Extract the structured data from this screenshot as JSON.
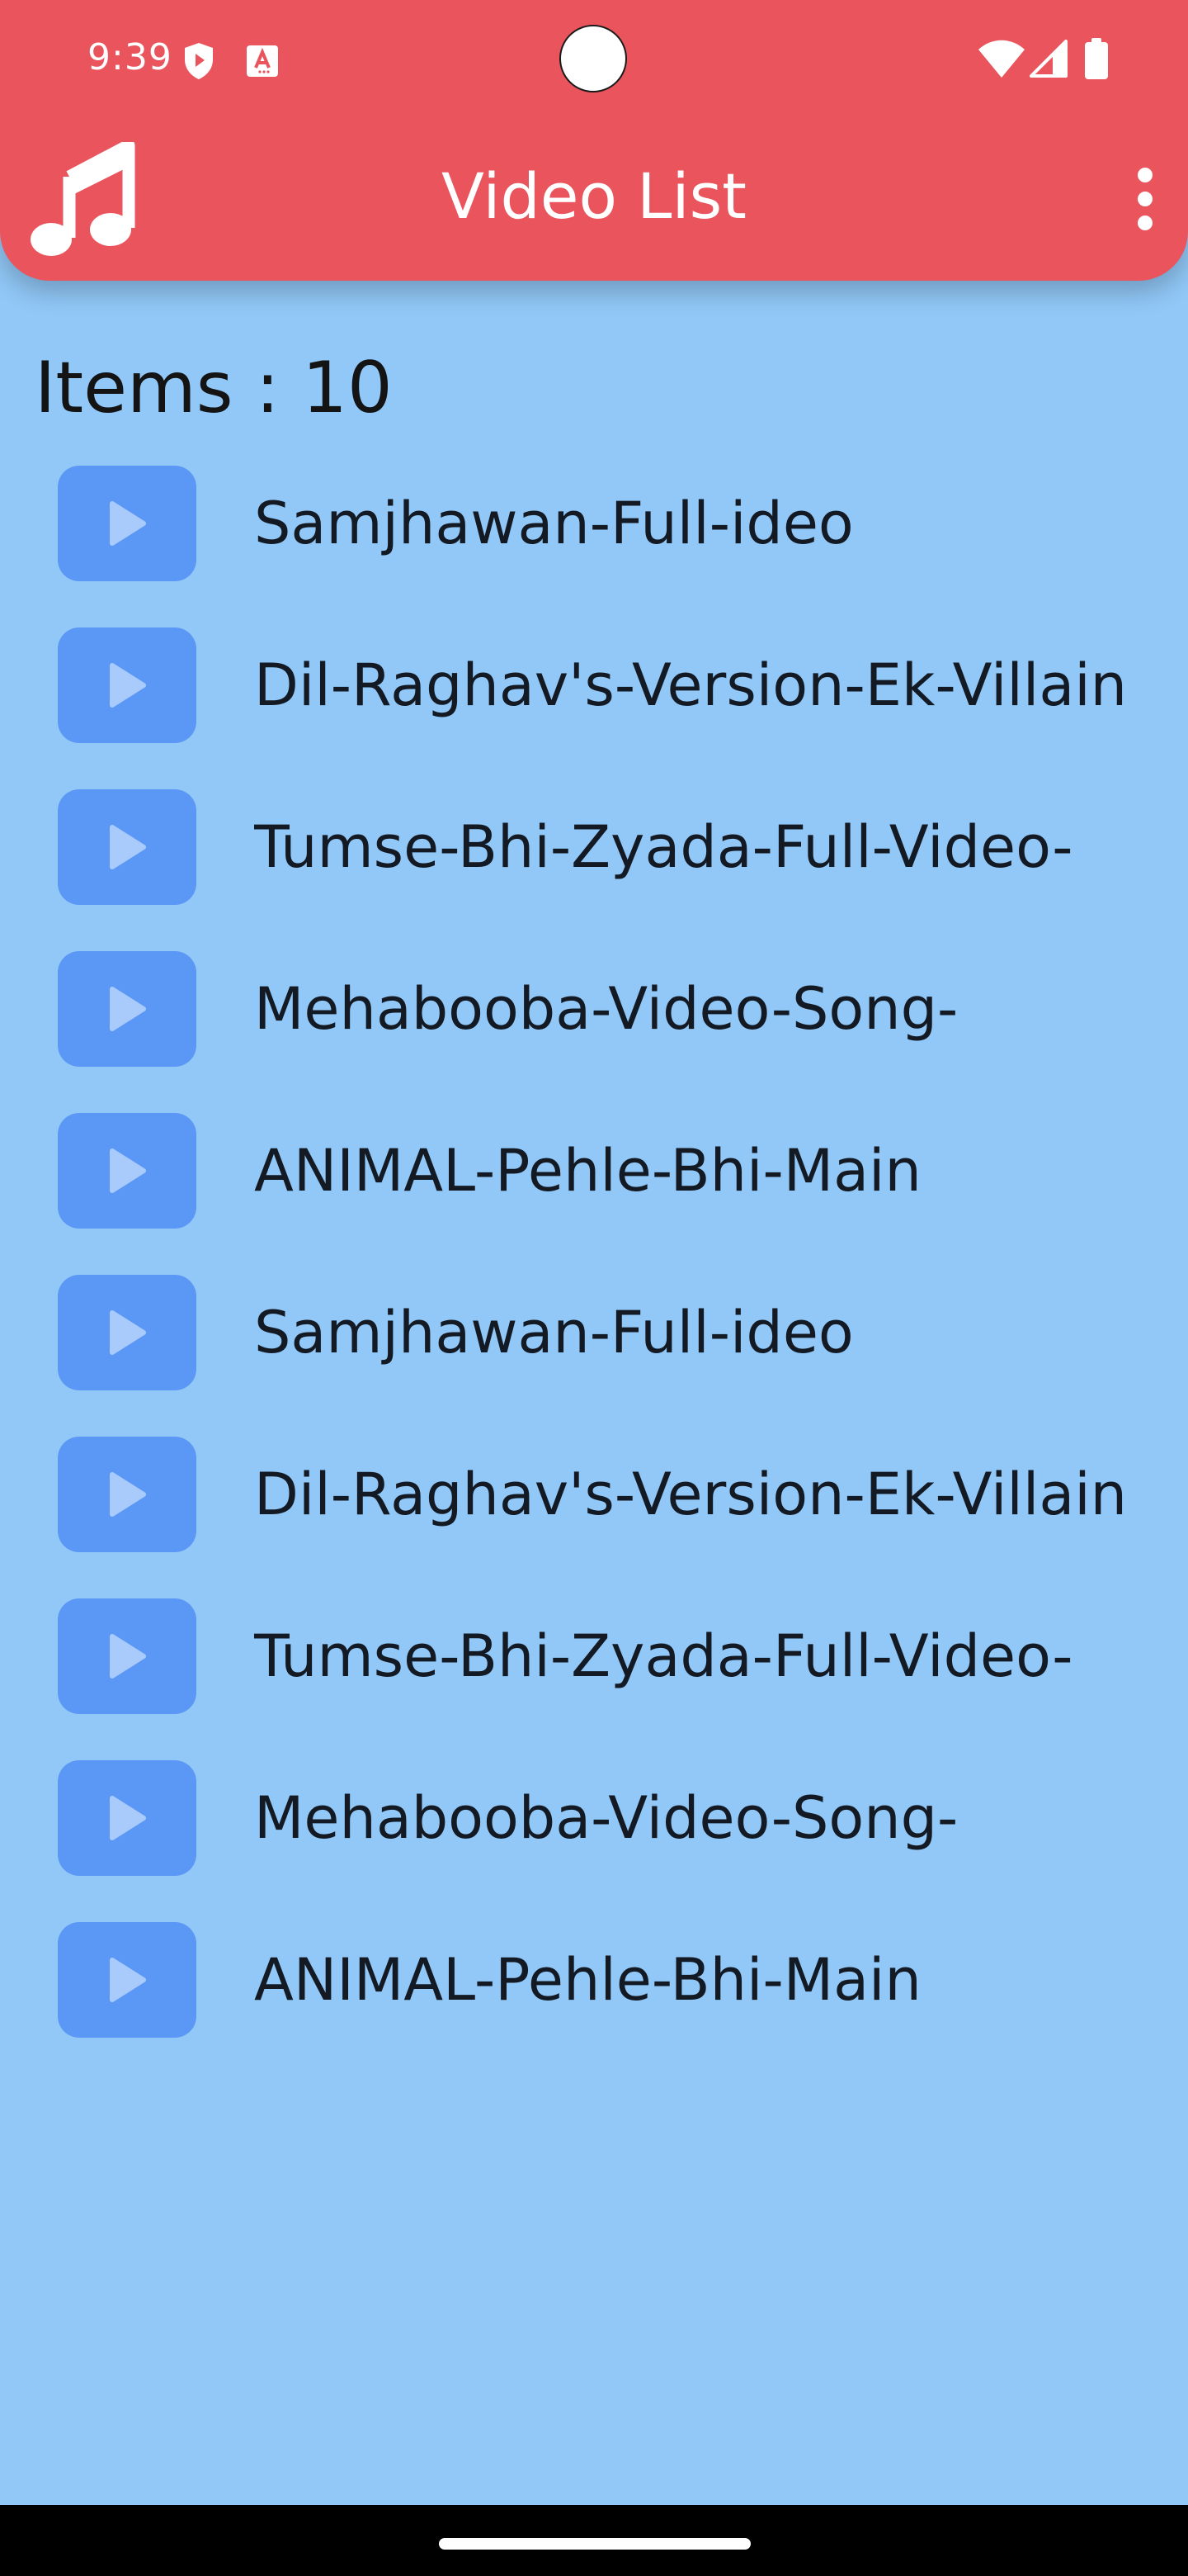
{
  "status_bar": {
    "time": "9:39",
    "icons": [
      "shield-icon",
      "font-a-icon",
      "wifi-icon",
      "cellular-icon",
      "battery-icon"
    ]
  },
  "app_bar": {
    "title": "Video List",
    "logo_icon": "music-note-icon",
    "menu_icon": "more-vert-icon",
    "background_color": "#e9545d"
  },
  "content": {
    "items_label": "Items : 10",
    "background_color": "#91c8f7",
    "videos": [
      {
        "title": "Samjhawan-Full-ideo"
      },
      {
        "title": "Dil-Raghav's-Version-Ek-Villain"
      },
      {
        "title": "Tumse-Bhi-Zyada-Full-Video-"
      },
      {
        "title": "Mehabooba-Video-Song-"
      },
      {
        "title": "ANIMAL-Pehle-Bhi-Main"
      },
      {
        "title": "Samjhawan-Full-ideo"
      },
      {
        "title": "Dil-Raghav's-Version-Ek-Villain"
      },
      {
        "title": "Tumse-Bhi-Zyada-Full-Video-"
      },
      {
        "title": "Mehabooba-Video-Song-"
      },
      {
        "title": "ANIMAL-Pehle-Bhi-Main"
      }
    ]
  },
  "colors": {
    "play_tile": "#5b98f5",
    "play_icon": "#a9cbfb"
  }
}
